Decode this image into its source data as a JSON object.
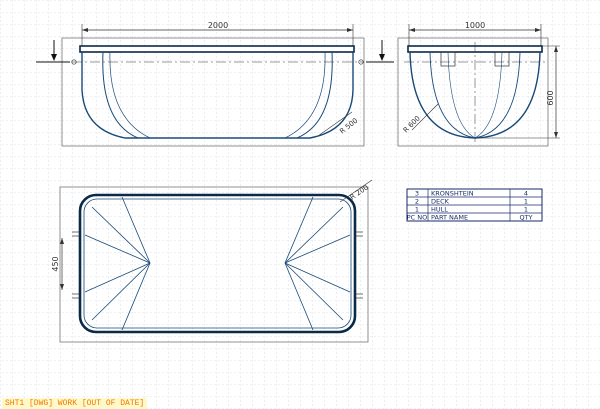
{
  "colors": {
    "grid": "#bcc8d6",
    "outline": "#777777",
    "hull": "#1a4a78",
    "hull_dark": "#0a2a48",
    "dims": "#333333",
    "status_text": "#f07800"
  },
  "side_view": {
    "dim_length": "2000",
    "dim_radius": "R 500"
  },
  "end_view": {
    "dim_width": "1000",
    "dim_height": "600",
    "dim_radius": "R 600"
  },
  "plan_view": {
    "dim_width": "450",
    "dim_corner": "R 200"
  },
  "parts_table": {
    "rows": [
      {
        "pos": "3",
        "name": "KRONSHTEIN",
        "qty": "4"
      },
      {
        "pos": "2",
        "name": "DECK",
        "qty": "1"
      },
      {
        "pos": "1",
        "name": "HULL",
        "qty": "1"
      }
    ],
    "header": {
      "pos": "PC NO",
      "name": "PART NAME",
      "qty": "QTY"
    }
  },
  "status_bar": "SHT1 [DWG] WORK [OUT OF DATE]"
}
